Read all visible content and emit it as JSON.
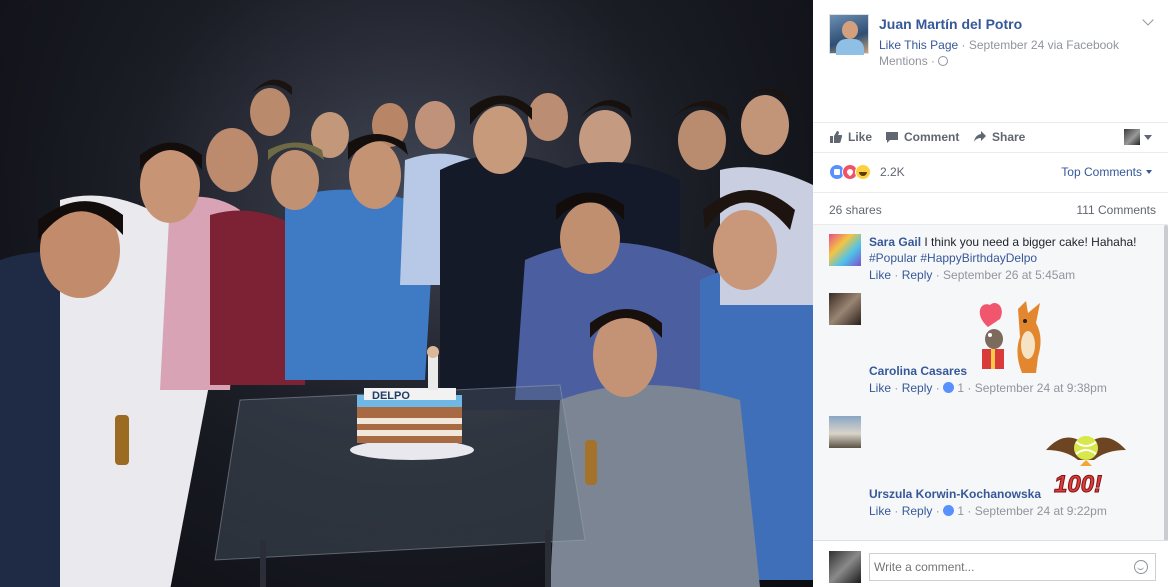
{
  "post": {
    "page_name": "Juan Martín del Potro",
    "like_page": "Like This Page",
    "date": "September 24",
    "via": "via Facebook",
    "mentions": "Mentions"
  },
  "actions": {
    "like": "Like",
    "comment": "Comment",
    "share": "Share"
  },
  "stats": {
    "reaction_count": "2.2K",
    "top_comments": "Top Comments",
    "shares": "26 shares",
    "comments": "111 Comments"
  },
  "photo": {
    "cake_text": "DELPO"
  },
  "comments": [
    {
      "name": "Sara Gail",
      "text": "I think you need a bigger cake! Hahaha!",
      "tags": "#Popular #HappyBirthdayDelpo",
      "like": "Like",
      "reply": "Reply",
      "likes": "",
      "time": "September 26 at 5:45am"
    },
    {
      "name": "Carolina Casares",
      "text": "",
      "tags": "",
      "like": "Like",
      "reply": "Reply",
      "likes": "1",
      "time": "September 24 at 9:38pm"
    },
    {
      "name": "Urszula Korwin-Kochanowska",
      "text": "",
      "tags": "",
      "like": "Like",
      "reply": "Reply",
      "likes": "1",
      "time": "September 24 at 9:22pm",
      "sticker_text": "100!"
    }
  ],
  "composer": {
    "placeholder": "Write a comment..."
  },
  "colors": {
    "link": "#365899",
    "muted": "#90949c",
    "panel_bg": "#f6f7f9"
  }
}
